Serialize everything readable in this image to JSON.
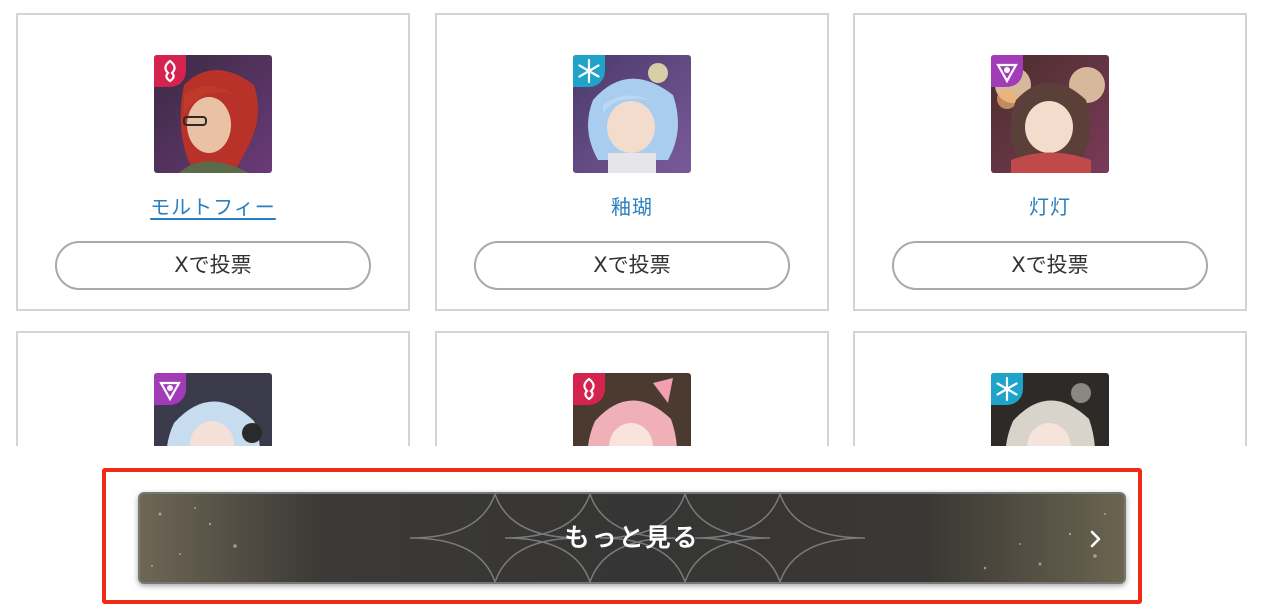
{
  "characters": [
    {
      "name": "モルトフィー",
      "element": "fire-element-icon",
      "vote_label": "Xで投票"
    },
    {
      "name": "釉瑚",
      "element": "ice-element-icon",
      "vote_label": "Xで投票"
    },
    {
      "name": "灯灯",
      "element": "void-element-icon",
      "vote_label": "Xで投票"
    },
    {
      "name": "",
      "element": "void-element-icon",
      "vote_label": ""
    },
    {
      "name": "",
      "element": "fire-element-icon",
      "vote_label": ""
    },
    {
      "name": "",
      "element": "ice-element-icon",
      "vote_label": ""
    }
  ],
  "more_button": {
    "label": "もっと見る"
  },
  "colors": {
    "link": "#2a7fc0",
    "fire_badge": "#d4234f",
    "ice_badge": "#1fa3c9",
    "void_badge": "#a23bb8",
    "highlight": "#ee2b16"
  }
}
